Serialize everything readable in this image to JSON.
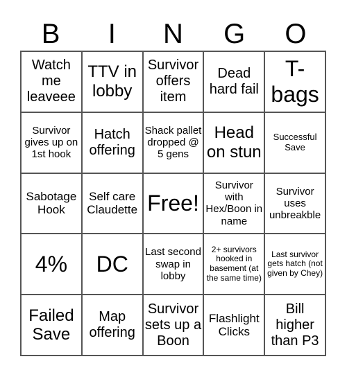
{
  "header": {
    "letters": [
      "B",
      "I",
      "N",
      "G",
      "O"
    ]
  },
  "cells": [
    {
      "text": "Watch me leaveee",
      "size": "m"
    },
    {
      "text": "TTV in lobby",
      "size": "l"
    },
    {
      "text": "Survivor offers item",
      "size": "m"
    },
    {
      "text": "Dead hard fail",
      "size": "m"
    },
    {
      "text": "T-bags",
      "size": "xl"
    },
    {
      "text": "Survivor gives up on 1st hook",
      "size": "s"
    },
    {
      "text": "Hatch offering",
      "size": "m"
    },
    {
      "text": "Shack pallet dropped @ 5 gens",
      "size": "s"
    },
    {
      "text": "Head on stun",
      "size": "l"
    },
    {
      "text": "Successful Save",
      "size": "xs"
    },
    {
      "text": "Sabotage Hook",
      "size": "ms"
    },
    {
      "text": "Self care Claudette",
      "size": "ms"
    },
    {
      "text": "Free!",
      "size": "xl"
    },
    {
      "text": "Survivor with Hex/Boon in name",
      "size": "s"
    },
    {
      "text": "Survivor uses unbreakble",
      "size": "s"
    },
    {
      "text": "4%",
      "size": "xl"
    },
    {
      "text": "DC",
      "size": "xl"
    },
    {
      "text": "Last second swap in lobby",
      "size": "s"
    },
    {
      "text": "2+ survivors hooked in basement (at the same time)",
      "size": "xxs"
    },
    {
      "text": "Last survivor gets hatch (not given by Chey)",
      "size": "xxs"
    },
    {
      "text": "Failed Save",
      "size": "l"
    },
    {
      "text": "Map offering",
      "size": "m"
    },
    {
      "text": "Survivor sets up a Boon",
      "size": "m"
    },
    {
      "text": "Flashlight Clicks",
      "size": "ms"
    },
    {
      "text": "Bill higher than P3",
      "size": "m"
    }
  ]
}
